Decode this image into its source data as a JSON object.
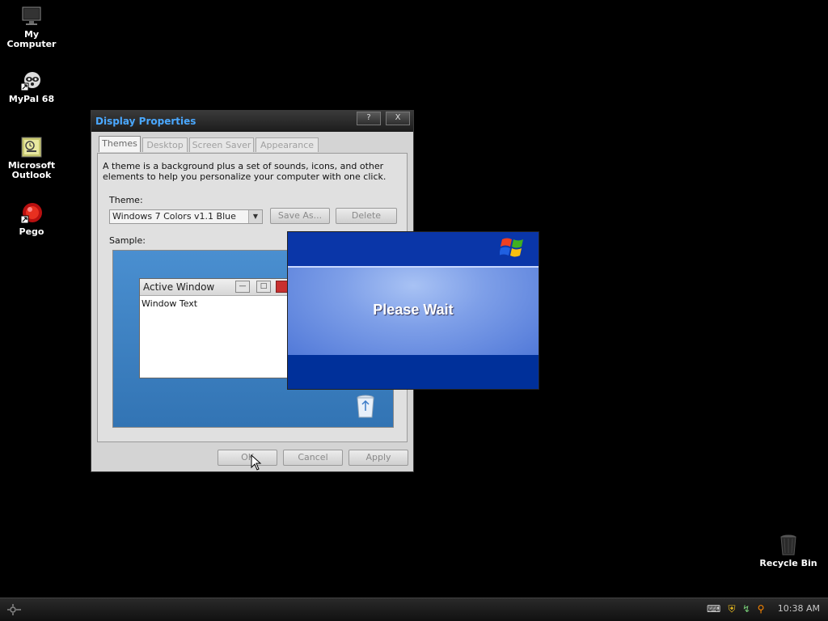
{
  "desktop": {
    "icons": [
      {
        "label": "My Computer",
        "icon": "monitor-icon"
      },
      {
        "label": "MyPal 68",
        "icon": "raccoon-icon"
      },
      {
        "label": "Microsoft Outlook",
        "icon": "outlook-icon"
      },
      {
        "label": "Pego",
        "icon": "pego-icon"
      },
      {
        "label": "Recycle Bin",
        "icon": "trash-bin-icon"
      }
    ]
  },
  "dialog": {
    "title": "Display Properties",
    "title_color": "#4aa8ff",
    "help_button": "?",
    "close_button": "X",
    "tabs": [
      {
        "label": "Themes",
        "active": true
      },
      {
        "label": "Desktop",
        "active": false
      },
      {
        "label": "Screen Saver",
        "active": false
      },
      {
        "label": "Appearance",
        "active": false
      }
    ],
    "description": "A theme is a background plus a set of sounds, icons, and other elements to help you personalize your computer with one click.",
    "theme_label": "Theme:",
    "theme_value": "Windows 7 Colors v1.1 Blue",
    "save_as_label": "Save As...",
    "delete_label": "Delete",
    "sample_label": "Sample:",
    "sample": {
      "window_title": "Active Window",
      "window_text": "Window Text"
    },
    "ok_label": "OK",
    "cancel_label": "Cancel",
    "apply_label": "Apply"
  },
  "wait_screen": {
    "message": "Please Wait"
  },
  "taskbar": {
    "clock": "10:38 AM",
    "tray_icons": [
      "keyboard-icon",
      "shield-icon",
      "network-icon",
      "search-icon"
    ]
  }
}
